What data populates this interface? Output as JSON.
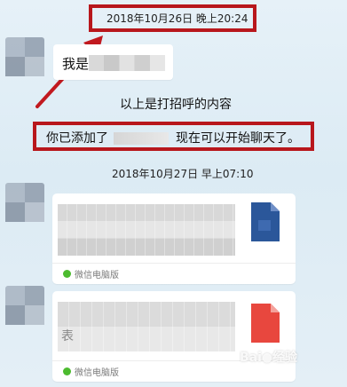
{
  "timestamps": {
    "first": "2018年10月26日 晚上20:24",
    "second": "2018年10月27日 早上07:10"
  },
  "messages": {
    "greeting_prefix": "我是"
  },
  "system": {
    "greeting_note": "以上是打招呼的内容",
    "added_prefix": "你已添加了",
    "added_suffix": "现在可以开始聊天了。"
  },
  "cards": [
    {
      "source": "微信电脑版",
      "file_type": "doc",
      "icon": "word-document-icon",
      "color": "#2b579a"
    },
    {
      "source": "微信电脑版",
      "file_type": "pdf",
      "icon": "pdf-document-icon",
      "color": "#e8473e",
      "visible_fragment": "表"
    }
  ],
  "watermark": {
    "brand": "Bai",
    "suffix": "经验"
  },
  "colors": {
    "highlight_border": "#b8171c",
    "arrow": "#c1191f"
  }
}
